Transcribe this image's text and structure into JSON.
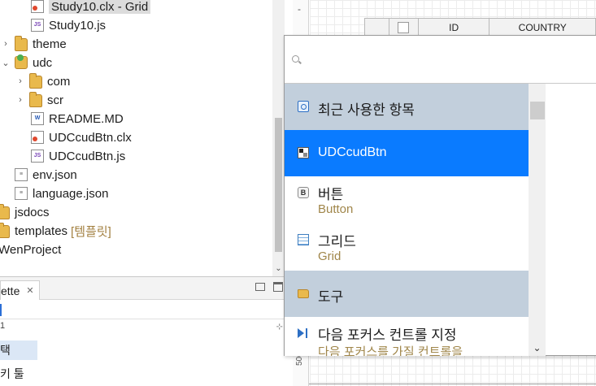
{
  "tree": {
    "items": [
      {
        "label": "Study10.clx - Grid",
        "icon": "clx-file-icon",
        "decoration": ""
      },
      {
        "label": "Study10.js",
        "icon": "js-file-icon",
        "decoration": ""
      },
      {
        "label": "theme",
        "icon": "folder-icon",
        "decoration": ""
      },
      {
        "label": "udc",
        "icon": "project-folder-icon",
        "decoration": ""
      },
      {
        "label": "com",
        "icon": "folder-icon",
        "decoration": ""
      },
      {
        "label": "scr",
        "icon": "folder-icon",
        "decoration": ""
      },
      {
        "label": "README.MD",
        "icon": "doc-file-icon",
        "decoration": ""
      },
      {
        "label": "UDCcudBtn.clx",
        "icon": "clx-file-icon",
        "decoration": ""
      },
      {
        "label": "UDCcudBtn.js",
        "icon": "js-file-icon",
        "decoration": ""
      },
      {
        "label": "env.json",
        "icon": "json-file-icon",
        "decoration": ""
      },
      {
        "label": "language.json",
        "icon": "json-file-icon",
        "decoration": ""
      },
      {
        "label": "jsdocs",
        "icon": "folder-icon",
        "decoration": ""
      },
      {
        "label": "templates",
        "icon": "folder-icon",
        "decoration": "[템플릿]"
      },
      {
        "label": "WenProject",
        "icon": "",
        "decoration": ""
      }
    ]
  },
  "palette": {
    "tab_label": "ette",
    "close_glyph": "✕",
    "group_label": "1",
    "items": [
      "택",
      "키 툴"
    ]
  },
  "editor": {
    "ruler_minus": "-",
    "ruler_number": "500",
    "grid_columns": [
      "ID",
      "COUNTRY"
    ]
  },
  "popup": {
    "search_value": "",
    "rows": [
      {
        "kind": "category",
        "title": "최근 사용한 항목",
        "icon": "recent-items-icon"
      },
      {
        "kind": "selected",
        "title": "UDCcudBtn",
        "icon": "udc-component-icon"
      },
      {
        "kind": "item",
        "title": "버튼",
        "subtitle": "Button",
        "icon": "button-control-icon"
      },
      {
        "kind": "item",
        "title": "그리드",
        "subtitle": "Grid",
        "icon": "grid-control-icon"
      },
      {
        "kind": "category",
        "title": "도구",
        "icon": "folder-icon"
      },
      {
        "kind": "item",
        "title": "다음 포커스 컨트롤 지정",
        "subtitle": "다음 포커스를 가질 컨트롤을",
        "icon": "next-focus-icon"
      }
    ],
    "colors": {
      "category_bg": "#c2cfdc",
      "selected_bg": "#0a7bff",
      "subtitle_text": "#a0864a"
    }
  }
}
